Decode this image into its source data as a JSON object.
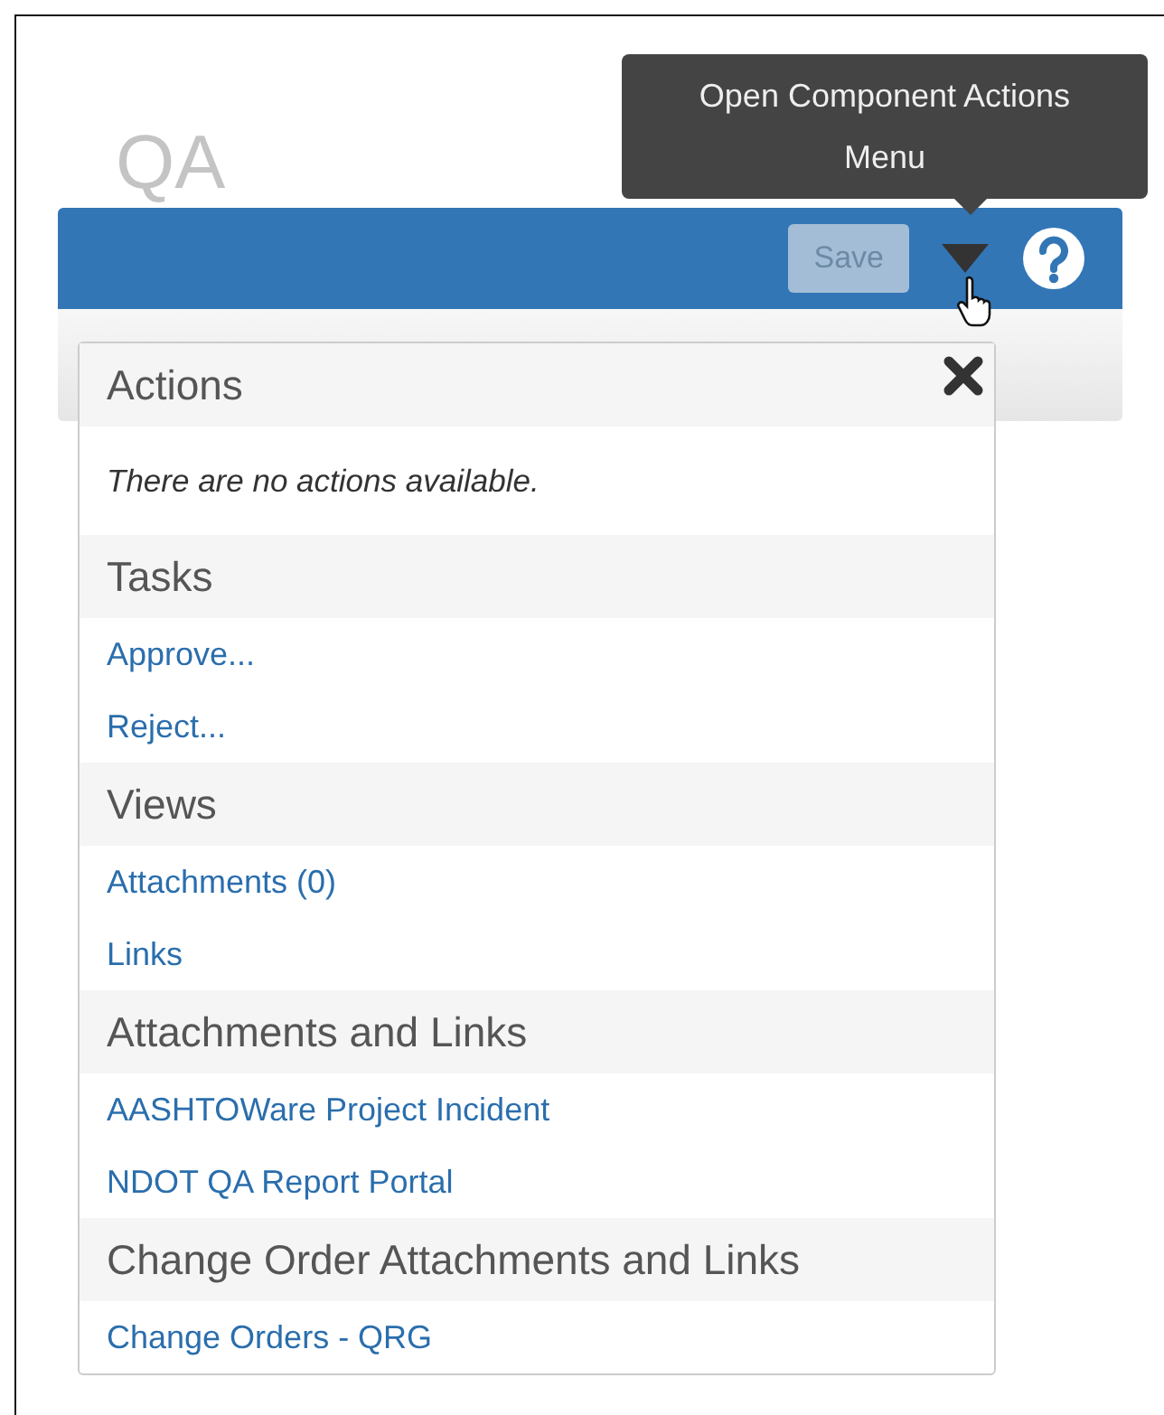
{
  "page_title": "QA",
  "toolbar": {
    "buttons": [
      {
        "label": "Save",
        "disabled": true
      }
    ]
  },
  "tooltip": {
    "text": "Open Component Actions Menu"
  },
  "actions_menu": {
    "title": "Actions",
    "message": "There are no actions available.",
    "sections": [
      {
        "heading": "Tasks",
        "links": [
          "Approve...",
          "Reject..."
        ]
      },
      {
        "heading": "Views",
        "links": [
          "Attachments (0)",
          "Links"
        ]
      },
      {
        "heading": "Attachments and Links",
        "links": [
          "AASHTOWare Project Incident",
          "NDOT QA Report Portal"
        ]
      },
      {
        "heading": "Change Order Attachments and Links",
        "links": [
          "Change Orders - QRG"
        ]
      }
    ]
  }
}
